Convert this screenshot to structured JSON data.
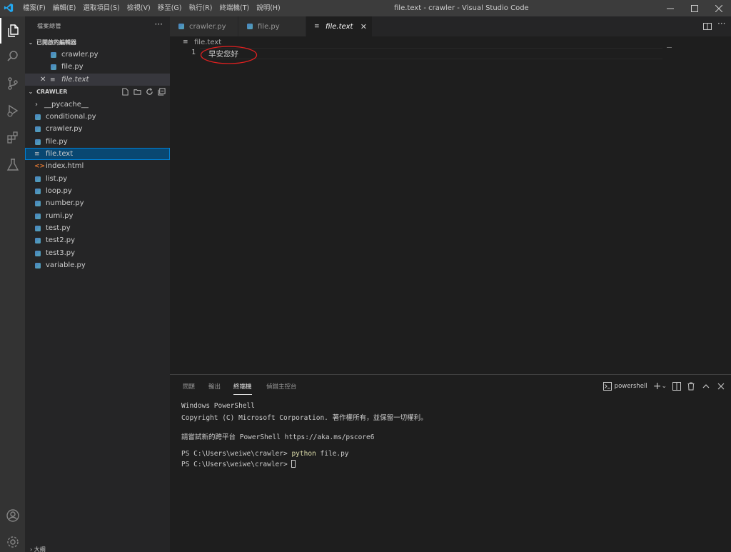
{
  "titlebar": {
    "menu": [
      "檔案(F)",
      "編輯(E)",
      "選取項目(S)",
      "檢視(V)",
      "移至(G)",
      "執行(R)",
      "終端機(T)",
      "說明(H)"
    ],
    "title": "file.text - crawler - Visual Studio Code"
  },
  "sidebar": {
    "title": "檔案總管",
    "open_editors_label": "已開啟的編輯器",
    "open_editors": [
      "crawler.py",
      "file.py",
      "file.text"
    ],
    "folder_label": "CRAWLER",
    "files": [
      "__pycache__",
      "conditional.py",
      "crawler.py",
      "file.py",
      "file.text",
      "index.html",
      "list.py",
      "loop.py",
      "number.py",
      "rumi.py",
      "test.py",
      "test2.py",
      "test3.py",
      "variable.py"
    ],
    "outline_label": "大綱"
  },
  "tabs": [
    "crawler.py",
    "file.py",
    "file.text"
  ],
  "editor": {
    "breadcrumb": "file.text",
    "line_number": "1",
    "line_text": "早安您好"
  },
  "panel": {
    "tabs": [
      "問題",
      "輸出",
      "終端機",
      "偵錯主控台"
    ],
    "shell_label": "powershell",
    "terminal": {
      "l1": "Windows PowerShell",
      "l2": "Copyright (C) Microsoft Corporation. 著作權所有，並保留一切權利。",
      "l3": "請嘗試新的跨平台 PowerShell https://aka.ms/pscore6",
      "l4_prompt": "PS C:\\Users\\weiwe\\crawler> ",
      "l4_cmd": "python",
      "l4_arg": " file.py",
      "l5_prompt": "PS C:\\Users\\weiwe\\crawler> "
    }
  },
  "colors": {
    "accent": "#007acc",
    "annotation": "#e02020",
    "selection": "#094771"
  }
}
